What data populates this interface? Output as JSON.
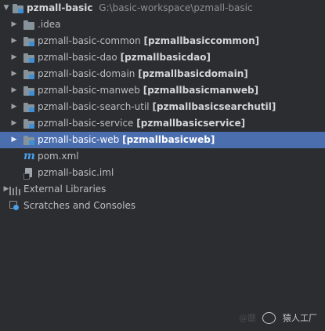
{
  "project": {
    "name": "pzmall-basic",
    "path": "G:\\basic-workspace\\pzmall-basic"
  },
  "tree": [
    {
      "label": ".idea",
      "module": ""
    },
    {
      "label": "pzmall-basic-common",
      "module": "[pzmallbasiccommon]"
    },
    {
      "label": "pzmall-basic-dao",
      "module": "[pzmallbasicdao]"
    },
    {
      "label": "pzmall-basic-domain",
      "module": "[pzmallbasicdomain]"
    },
    {
      "label": "pzmall-basic-manweb",
      "module": "[pzmallbasicmanweb]"
    },
    {
      "label": "pzmall-basic-search-util",
      "module": "[pzmallbasicsearchutil]"
    },
    {
      "label": "pzmall-basic-service",
      "module": "[pzmallbasicservice]"
    },
    {
      "label": "pzmall-basic-web",
      "module": "[pzmallbasicweb]"
    }
  ],
  "files": {
    "pom": "pom.xml",
    "iml": "pzmall-basic.iml"
  },
  "external_libraries": "External Libraries",
  "scratches": "Scratches and Consoles",
  "watermark": {
    "faint": "@蘑",
    "text": "猿人工厂"
  },
  "colors": {
    "background": "#2b2d30",
    "selection": "#4b6eaf",
    "module_accent": "#3f8fd6"
  }
}
